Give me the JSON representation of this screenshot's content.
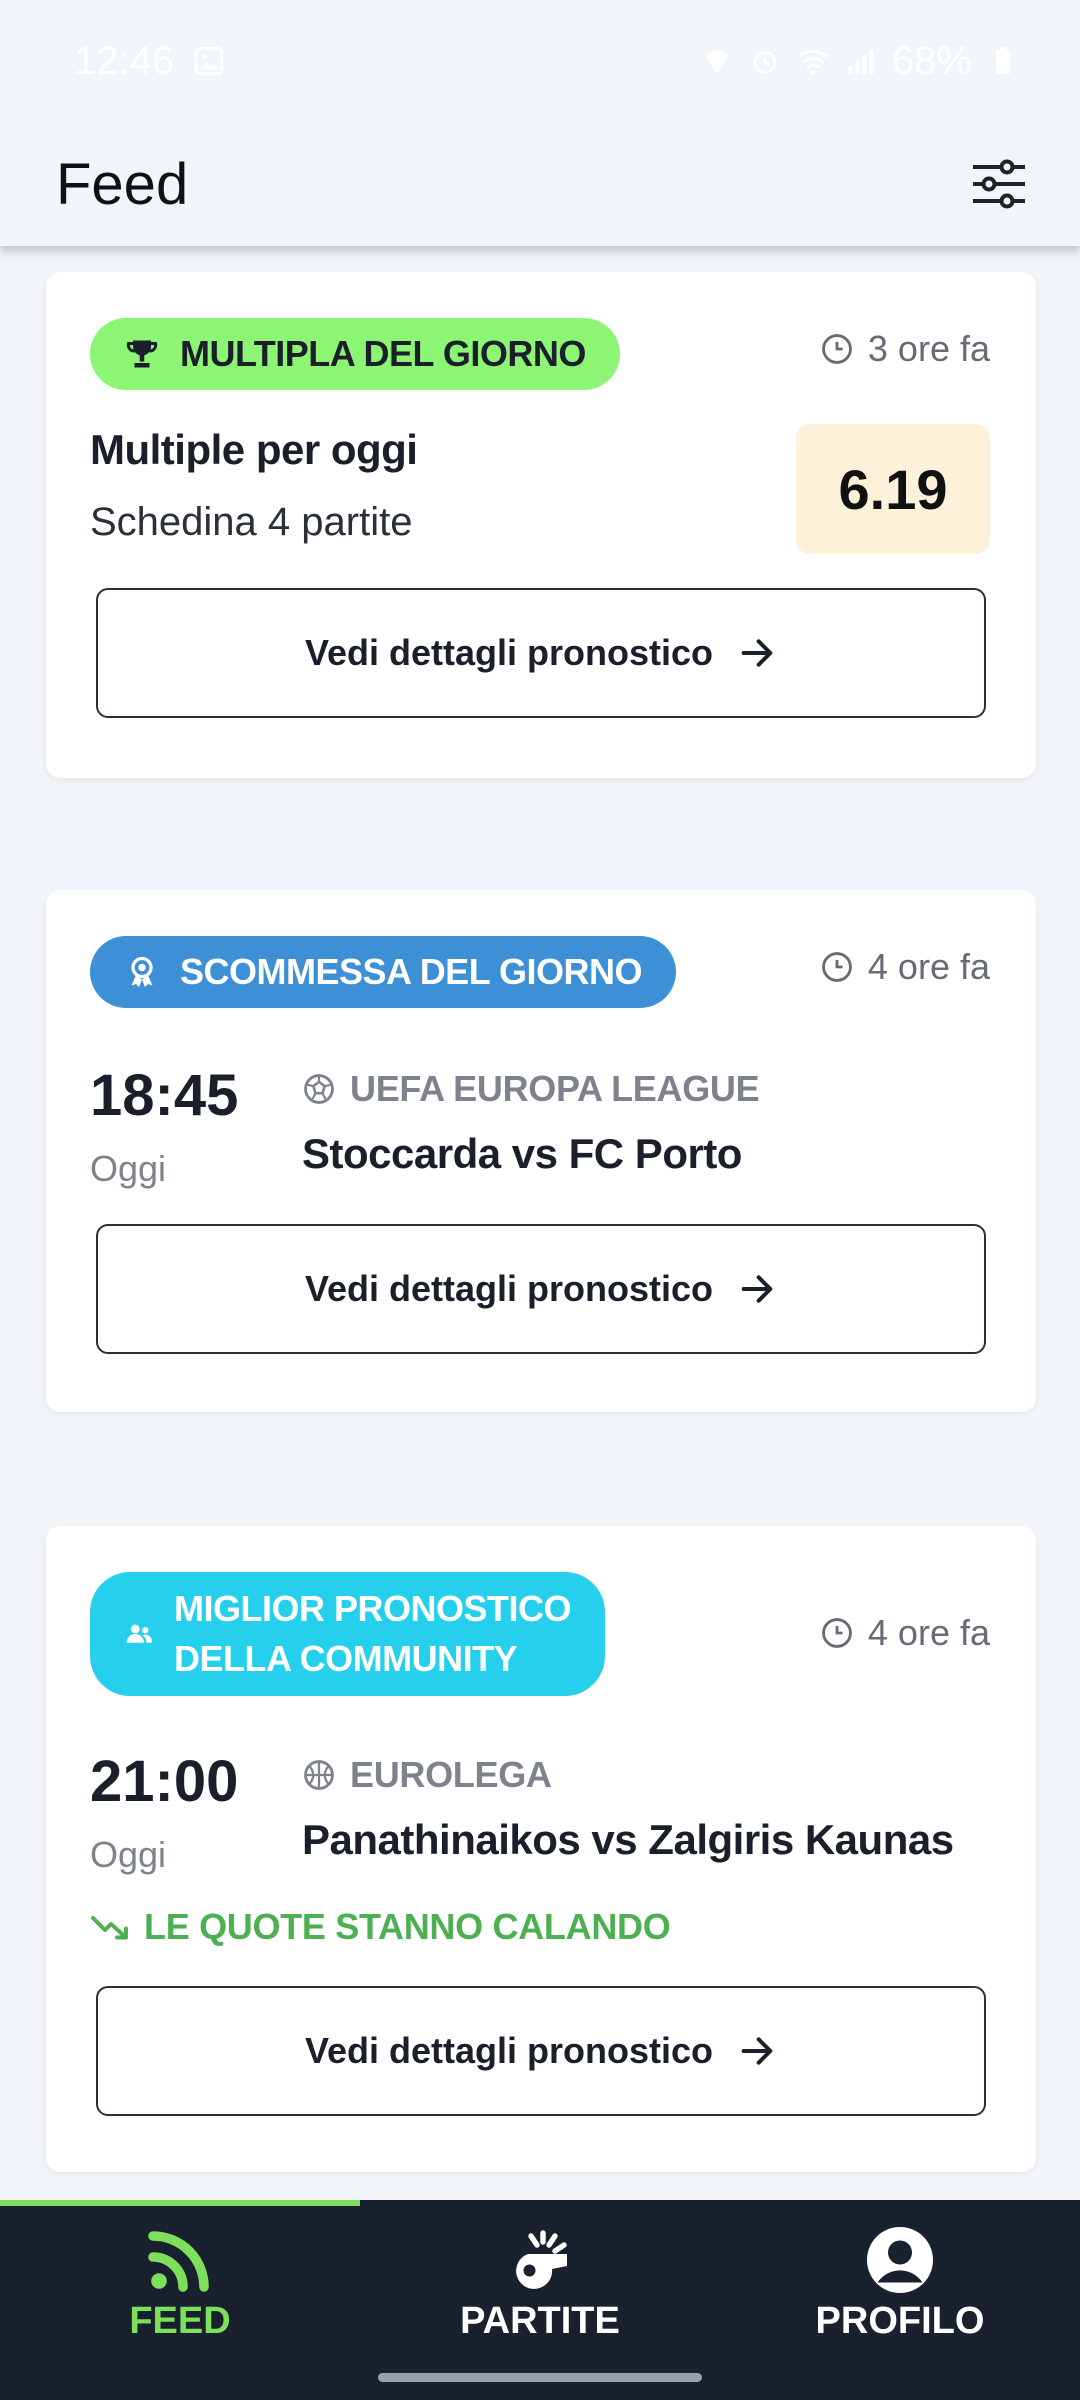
{
  "status_bar": {
    "time": "12:46",
    "battery": "68%",
    "icons": [
      "image-icon",
      "location-icon",
      "alarm-icon",
      "wifi-icon",
      "signal-icon",
      "battery-icon"
    ]
  },
  "header": {
    "title": "Feed",
    "filter_icon": "sliders-icon"
  },
  "cards": [
    {
      "badge": "MULTIPLA DEL GIORNO",
      "badge_icon": "trophy-icon",
      "time_ago": "3 ore fa",
      "title": "Multiple per oggi",
      "subtitle": "Schedina 4 partite",
      "odd": "6.19",
      "button": "Vedi dettagli pronostico"
    },
    {
      "badge": "SCOMMESSA DEL GIORNO",
      "badge_icon": "award-icon",
      "time_ago": "4 ore fa",
      "match_time": "18:45",
      "match_day": "Oggi",
      "league": "UEFA EUROPA LEAGUE",
      "league_icon": "soccer-ball-icon",
      "teams": "Stoccarda vs FC Porto",
      "button": "Vedi dettagli pronostico"
    },
    {
      "badge_line1": "MIGLIOR PRONOSTICO",
      "badge_line2": "DELLA COMMUNITY",
      "badge_icon": "community-icon",
      "time_ago": "4 ore fa",
      "match_time": "21:00",
      "match_day": "Oggi",
      "league": "EUROLEGA",
      "league_icon": "basketball-icon",
      "teams": "Panathinaikos vs Zalgiris Kaunas",
      "trend": "LE QUOTE STANNO CALANDO",
      "button": "Vedi dettagli pronostico"
    }
  ],
  "bottom_nav": {
    "items": [
      {
        "label": "FEED",
        "icon": "rss-feed-icon",
        "active": true
      },
      {
        "label": "PARTITE",
        "icon": "whistle-icon",
        "active": false
      },
      {
        "label": "PROFILO",
        "icon": "user-icon",
        "active": false
      }
    ]
  },
  "colors": {
    "accent_green": "#7ddf5a",
    "badge_green": "#8cf573",
    "badge_blue": "#3d8fd6",
    "badge_cyan": "#26d0ec",
    "trend_green": "#4caf50",
    "nav_bg": "#19212f",
    "odd_bg": "#fdf1d9"
  }
}
